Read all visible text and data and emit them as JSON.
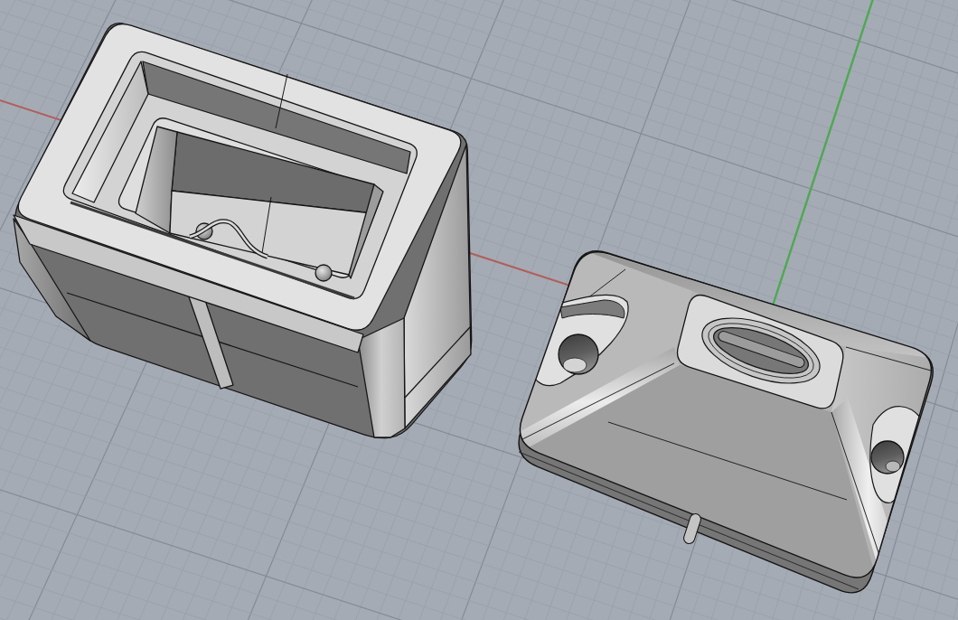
{
  "viewport": {
    "grid": true,
    "world_axes": true
  }
}
